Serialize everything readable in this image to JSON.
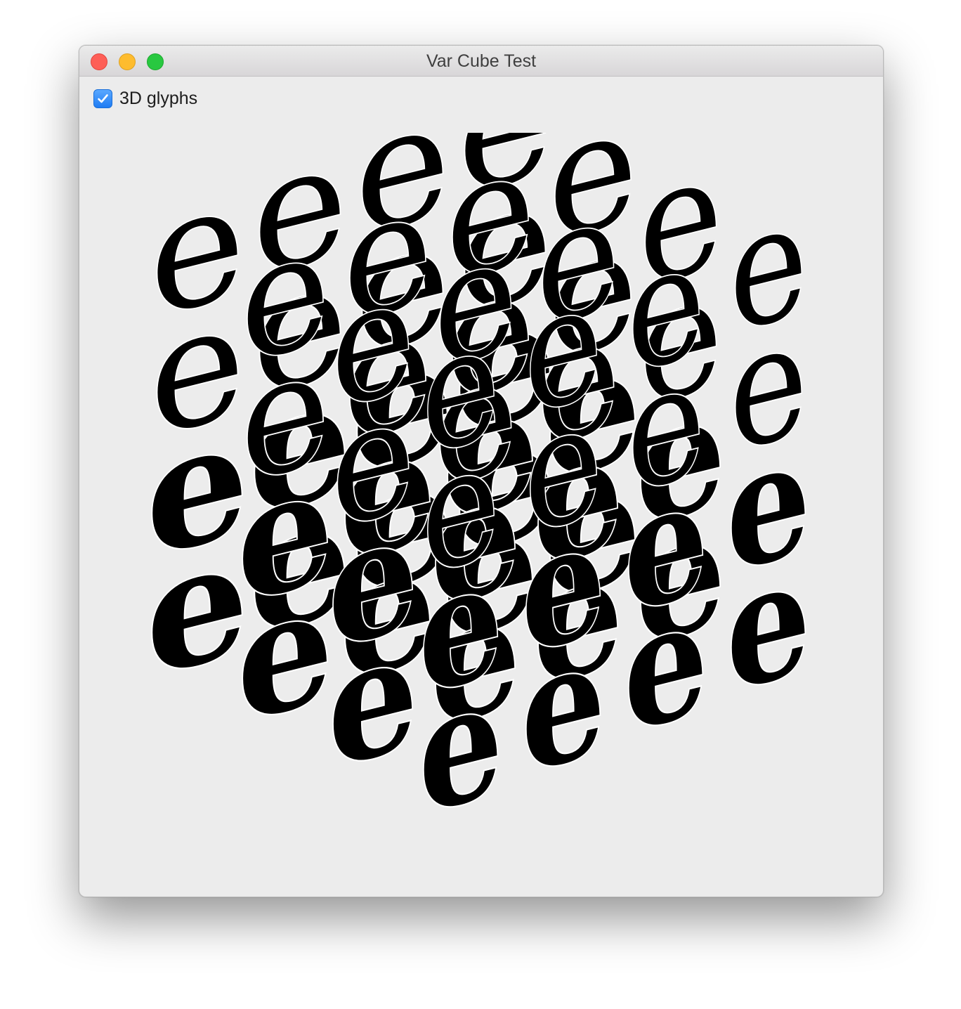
{
  "window": {
    "title": "Var Cube Test"
  },
  "controls": {
    "glyphs_3d": {
      "label": "3D glyphs",
      "checked": true
    }
  },
  "cube": {
    "glyph": "e",
    "columns": 4,
    "rows": 4,
    "layers": 4
  }
}
